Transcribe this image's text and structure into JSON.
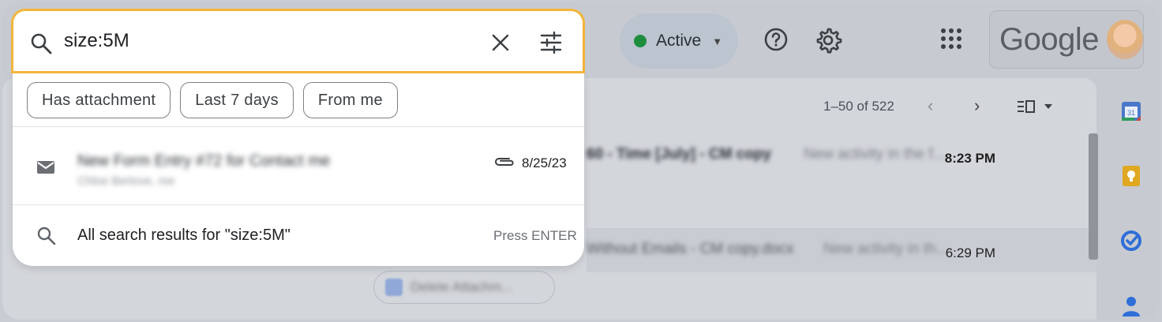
{
  "search": {
    "value": "size:5M",
    "clear_icon": "close-icon",
    "options_icon": "tune-icon"
  },
  "chips": [
    {
      "label": "Has attachment"
    },
    {
      "label": "Last 7 days"
    },
    {
      "label": "From me"
    }
  ],
  "suggestion": {
    "subject": "New Form Entry #72 for Contact me",
    "sender": "Chloe Berlove, me",
    "date": "8/25/23",
    "icon": "mail-icon",
    "attachment_icon": "paperclip-icon"
  },
  "all_results": {
    "label": "All search results for \"size:5M\"",
    "hint": "Press ENTER"
  },
  "header": {
    "status_label": "Active",
    "status_color": "#1e8e3e",
    "brand": "Google"
  },
  "list": {
    "pagination": "1–50 of 522",
    "rows": [
      {
        "subject": "60 - Time [July] - CM copy",
        "snippet": "New activity in the f...",
        "time": "8:23 PM",
        "unread": true
      },
      {
        "subject": "Without Emails - CM copy.docx",
        "snippet": "New activity in th...",
        "time": "6:29 PM",
        "unread": false
      }
    ],
    "attachment_chip": "Delete Attachm..."
  },
  "colors": {
    "search_border": "#f2b53a",
    "overlay_dim": "#c7cbd1"
  }
}
